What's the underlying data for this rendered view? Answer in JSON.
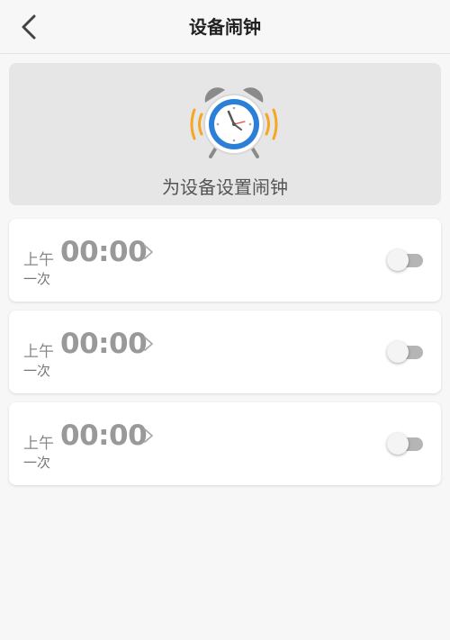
{
  "header": {
    "title": "设备闹钟",
    "back_icon": "chevron-left-icon"
  },
  "hero": {
    "icon": "alarm-clock-icon",
    "text": "为设备设置闹钟"
  },
  "alarms": [
    {
      "ampm": "上午",
      "time": "00:00",
      "repeat": "一次",
      "enabled": false
    },
    {
      "ampm": "上午",
      "time": "00:00",
      "repeat": "一次",
      "enabled": false
    },
    {
      "ampm": "上午",
      "time": "00:00",
      "repeat": "一次",
      "enabled": false
    }
  ],
  "colors": {
    "clock_blue": "#2b7fd6",
    "clock_ring": "#c9c9c9",
    "ring_orange": "#f5a623",
    "toggle_off": "#b5b5b5"
  }
}
